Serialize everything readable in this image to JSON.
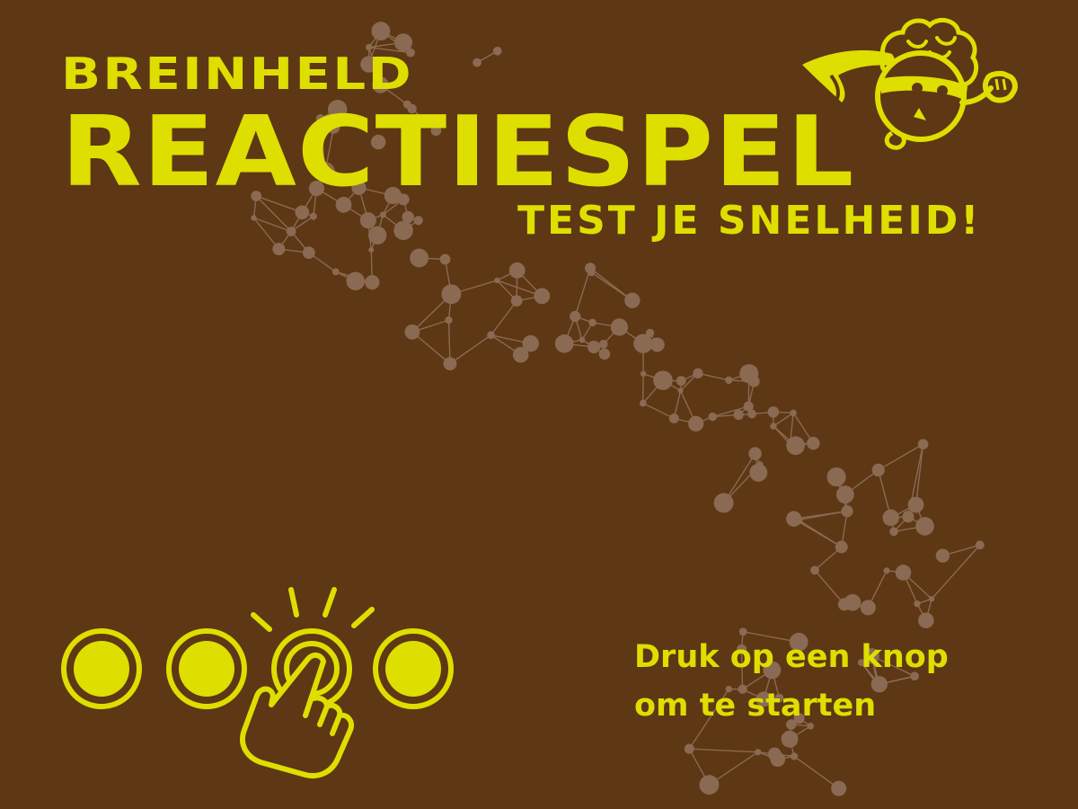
{
  "game": {
    "brand": "BREINHELD",
    "title": "REACTIESPEL",
    "subtitle": "TEST JE SNELHEID!",
    "instruction_line1": "Druk op een knop",
    "instruction_line2": "om te starten"
  },
  "colors": {
    "background": "#5e3714",
    "accent": "#dede00",
    "network": "#8a6a52"
  },
  "icons": {
    "mascot": "brain-superhero-icon",
    "buttons": [
      "arcade-button-icon",
      "arcade-button-icon",
      "arcade-button-icon",
      "arcade-button-icon"
    ],
    "pointer": "pointing-hand-icon"
  }
}
